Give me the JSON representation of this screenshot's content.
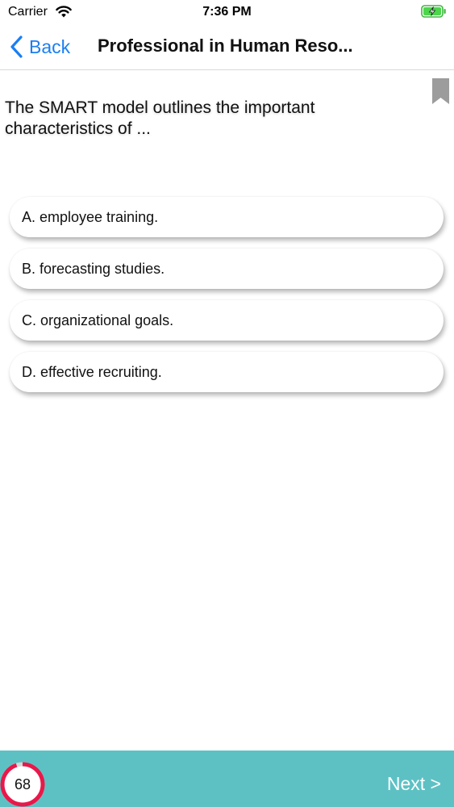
{
  "status_bar": {
    "carrier": "Carrier",
    "time": "7:36 PM",
    "wifi_icon": "wifi-icon",
    "battery_icon": "battery-charging-icon"
  },
  "nav": {
    "back_label": "Back",
    "title": "Professional in Human Reso...",
    "back_icon": "chevron-left-icon",
    "accent_color": "#1a7ff2"
  },
  "bookmark_icon": "bookmark-icon",
  "question": {
    "text": "The SMART model outlines the important characteristics of ..."
  },
  "answers": [
    {
      "label": "A. employee training."
    },
    {
      "label": "B. forecasting studies."
    },
    {
      "label": "C. organizational goals."
    },
    {
      "label": "D. effective recruiting."
    }
  ],
  "footer": {
    "progress_value": "68",
    "progress_fraction": 0.95,
    "next_label": "Next >",
    "bar_color": "#5dc1c4",
    "ring_color": "#e8184a"
  }
}
